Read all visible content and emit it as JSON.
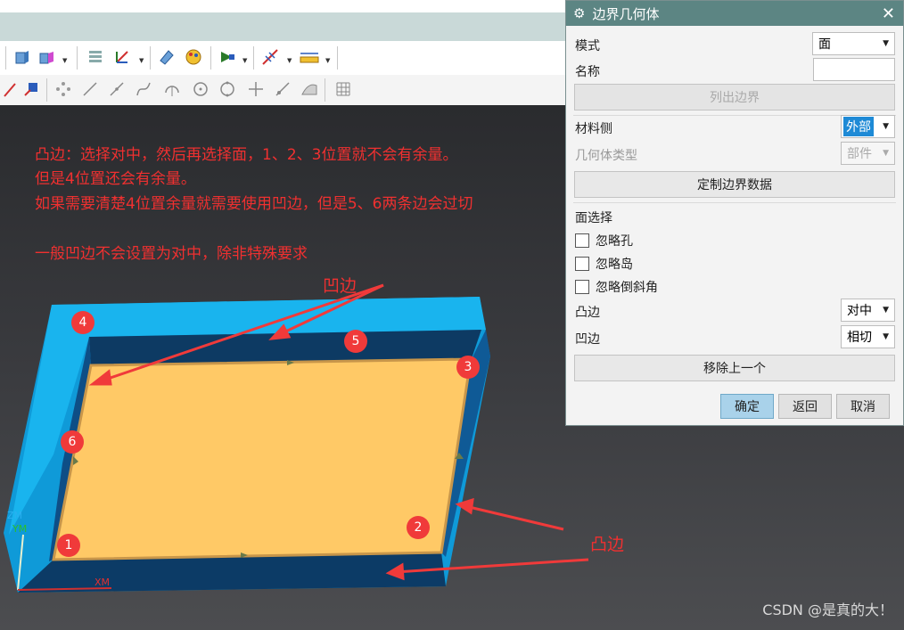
{
  "colors": {
    "accent": "#5c8583",
    "annotation": "#f03030",
    "selected_option_bg": "#1e8ad6"
  },
  "viewport": {
    "annotations": [
      "凸边：选择对中，然后再选择面，1、2、3位置就不会有余量。",
      "但是4位置还会有余量。",
      "如果需要清楚4位置余量就需要使用凹边，但是5、6两条边会过切",
      "一般凹边不会设置为对中，除非特殊要求"
    ],
    "label_concave": "凹边",
    "label_convex": "凸边",
    "badges": [
      "1",
      "2",
      "3",
      "4",
      "5",
      "6"
    ],
    "axis_zm": "ZM",
    "axis_ym": "YM",
    "axis_xm": "XM",
    "watermark": "CSDN @是真的大！"
  },
  "dialog": {
    "title": "边界几何体",
    "icon": "gear-icon",
    "mode_label": "模式",
    "mode_value": "面",
    "name_label": "名称",
    "name_value": "",
    "list_boundary": "列出边界",
    "material_side_label": "材料侧",
    "material_side_value": "外部",
    "geometry_type_label": "几何体类型",
    "geometry_type_value": "部件",
    "custom_boundary": "定制边界数据",
    "face_selection": "面选择",
    "ignore_holes": "忽略孔",
    "ignore_islands": "忽略岛",
    "ignore_chamfers": "忽略倒斜角",
    "convex_label": "凸边",
    "convex_value": "对中",
    "concave_label": "凹边",
    "concave_value": "相切",
    "remove_last": "移除上一个",
    "ok": "确定",
    "back": "返回",
    "cancel": "取消"
  }
}
